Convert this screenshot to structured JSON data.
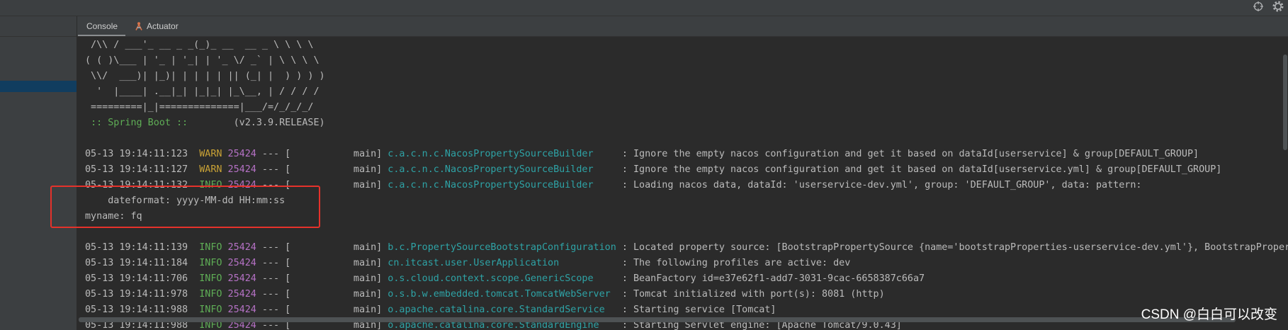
{
  "colors": {
    "background": "#2b2b2b",
    "panel": "#3c3f41",
    "text": "#bbbbbb",
    "warn": "#c9a236",
    "info": "#5fae56",
    "pid": "#b672c6",
    "logger": "#2ea3a6",
    "spring": "#5fae56",
    "selection": "#113d5f",
    "highlight_box": "#e5322b"
  },
  "toolbar": {
    "icons": [
      "crosshair-icon",
      "gear-icon"
    ]
  },
  "tabs": {
    "console": "Console",
    "actuator": "Actuator",
    "actuator_icon": "actuator-icon"
  },
  "console": {
    "lines": [
      {
        "type": "banner",
        "text": " /\\\\ / ___'_ __ _ _(_)_ __  __ _ \\ \\ \\ \\"
      },
      {
        "type": "banner",
        "text": "( ( )\\___ | '_ | '_| | '_ \\/ _` | \\ \\ \\ \\"
      },
      {
        "type": "banner",
        "text": " \\\\/  ___)| |_)| | | | | || (_| |  ) ) ) )"
      },
      {
        "type": "banner",
        "text": "  '  |____| .__|_| |_|_| |_\\__, | / / / /"
      },
      {
        "type": "banner",
        "text": " =========|_|==============|___/=/_/_/_/"
      },
      {
        "type": "spring",
        "label": ":: Spring Boot ::",
        "version": "(v2.3.9.RELEASE)"
      },
      {
        "type": "blank"
      },
      {
        "type": "log",
        "timestamp": "05-13 19:14:11:123",
        "level": "WARN",
        "pid": "25424",
        "dashes": "---",
        "thread": "[           main]",
        "logger": "c.a.c.n.c.NacosPropertySourceBuilder",
        "message": ": Ignore the empty nacos configuration and get it based on dataId[userservice] & group[DEFAULT_GROUP]"
      },
      {
        "type": "log",
        "timestamp": "05-13 19:14:11:127",
        "level": "WARN",
        "pid": "25424",
        "dashes": "---",
        "thread": "[           main]",
        "logger": "c.a.c.n.c.NacosPropertySourceBuilder",
        "message": ": Ignore the empty nacos configuration and get it based on dataId[userservice.yml] & group[DEFAULT_GROUP]"
      },
      {
        "type": "log",
        "timestamp": "05-13 19:14:11:132",
        "level": "INFO",
        "pid": "25424",
        "dashes": "---",
        "thread": "[           main]",
        "logger": "c.a.c.n.c.NacosPropertySourceBuilder",
        "message": ": Loading nacos data, dataId: 'userservice-dev.yml', group: 'DEFAULT_GROUP', data: pattern:"
      },
      {
        "type": "text",
        "text": "    dateformat: yyyy-MM-dd HH:mm:ss"
      },
      {
        "type": "text",
        "text": "myname: fq"
      },
      {
        "type": "blank"
      },
      {
        "type": "log",
        "timestamp": "05-13 19:14:11:139",
        "level": "INFO",
        "pid": "25424",
        "dashes": "---",
        "thread": "[           main]",
        "logger": "b.c.PropertySourceBootstrapConfiguration",
        "message": ": Located property source: [BootstrapPropertySource {name='bootstrapProperties-userservice-dev.yml'}, BootstrapPropert"
      },
      {
        "type": "log",
        "timestamp": "05-13 19:14:11:184",
        "level": "INFO",
        "pid": "25424",
        "dashes": "---",
        "thread": "[           main]",
        "logger": "cn.itcast.user.UserApplication",
        "message": ": The following profiles are active: dev"
      },
      {
        "type": "log",
        "timestamp": "05-13 19:14:11:706",
        "level": "INFO",
        "pid": "25424",
        "dashes": "---",
        "thread": "[           main]",
        "logger": "o.s.cloud.context.scope.GenericScope",
        "message": ": BeanFactory id=e37e62f1-add7-3031-9cac-6658387c66a7"
      },
      {
        "type": "log",
        "timestamp": "05-13 19:14:11:978",
        "level": "INFO",
        "pid": "25424",
        "dashes": "---",
        "thread": "[           main]",
        "logger": "o.s.b.w.embedded.tomcat.TomcatWebServer",
        "message": ": Tomcat initialized with port(s): 8081 (http)"
      },
      {
        "type": "log",
        "timestamp": "05-13 19:14:11:988",
        "level": "INFO",
        "pid": "25424",
        "dashes": "---",
        "thread": "[           main]",
        "logger": "o.apache.catalina.core.StandardService",
        "message": ": Starting service [Tomcat]"
      },
      {
        "type": "log",
        "timestamp": "05-13 19:14:11:988",
        "level": "INFO",
        "pid": "25424",
        "dashes": "---",
        "thread": "[           main]",
        "logger": "o.apache.catalina.core.StandardEngine",
        "message": ": Starting Servlet engine: [Apache Tomcat/9.0.43]"
      }
    ]
  },
  "watermark": "CSDN @白白可以改变"
}
